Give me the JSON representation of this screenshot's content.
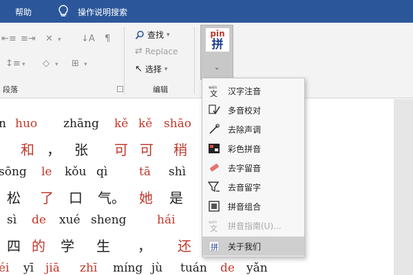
{
  "titlebar": {
    "help": "帮助",
    "bulb_icon": "lightbulb-icon",
    "search": "操作说明搜索"
  },
  "ribbon": {
    "paragraph_label": "段落",
    "edit_group": {
      "label": "编辑",
      "find": "查找",
      "replace": "Replace",
      "select": "选择"
    }
  },
  "pinyin_button": {
    "top": "pīn",
    "char": "拼"
  },
  "menu": {
    "items": [
      {
        "label": "汉字注音",
        "icon": "hanzi-zhuyin-icon",
        "enabled": true
      },
      {
        "label": "多音校对",
        "icon": "polyphone-check-icon",
        "enabled": true
      },
      {
        "label": "去除声调",
        "icon": "remove-tone-icon",
        "enabled": true
      },
      {
        "label": "彩色拼音",
        "icon": "color-pinyin-icon",
        "enabled": true
      },
      {
        "label": "去字留音",
        "icon": "eraser-icon",
        "enabled": true
      },
      {
        "label": "去音留字",
        "icon": "filter-icon",
        "enabled": true
      },
      {
        "label": "拼音组合",
        "icon": "pinyin-combine-icon",
        "enabled": true
      },
      {
        "label": "拼音指南(U)...",
        "icon": "pinyin-guide-icon",
        "enabled": false
      },
      {
        "label": "关于我们",
        "icon": "about-icon",
        "enabled": true
      }
    ]
  },
  "document": {
    "lines": [
      {
        "kind": "pinyin",
        "tokens": [
          {
            "t": "n",
            "red": false
          },
          {
            "t": "huo",
            "red": true
          },
          {
            "t": "zhāng",
            "red": false
          },
          {
            "t": "kě",
            "red": true
          },
          {
            "t": "kě",
            "red": true
          },
          {
            "t": "shāo",
            "red": true
          }
        ]
      },
      {
        "kind": "hanzi",
        "tokens": [
          {
            "t": "和",
            "red": true
          },
          {
            "t": "，",
            "red": false
          },
          {
            "t": "张",
            "red": false
          },
          {
            "t": "可",
            "red": true
          },
          {
            "t": "可",
            "red": true
          },
          {
            "t": "稍",
            "red": true
          }
        ]
      },
      {
        "kind": "pinyin",
        "tokens": [
          {
            "t": "sōng",
            "red": false
          },
          {
            "t": "le",
            "red": true
          },
          {
            "t": "kǒu",
            "red": false
          },
          {
            "t": "qì",
            "red": false
          },
          {
            "t": "tā",
            "red": true
          },
          {
            "t": "shì",
            "red": false
          }
        ]
      },
      {
        "kind": "hanzi",
        "tokens": [
          {
            "t": "松",
            "red": false
          },
          {
            "t": "了",
            "red": true
          },
          {
            "t": "口",
            "red": false
          },
          {
            "t": "气。",
            "red": false
          },
          {
            "t": "她",
            "red": true
          },
          {
            "t": "是",
            "red": false
          }
        ]
      },
      {
        "kind": "pinyin",
        "tokens": [
          {
            "t": "sì",
            "red": false
          },
          {
            "t": "de",
            "red": true
          },
          {
            "t": "xué",
            "red": false
          },
          {
            "t": "sheng",
            "red": false
          },
          {
            "t": "hái",
            "red": true
          }
        ]
      },
      {
        "kind": "hanzi",
        "tokens": [
          {
            "t": "四",
            "red": false
          },
          {
            "t": "的",
            "red": true
          },
          {
            "t": "学",
            "red": false
          },
          {
            "t": "生",
            "red": false
          },
          {
            "t": "，",
            "red": false
          },
          {
            "t": "还",
            "red": true
          }
        ]
      },
      {
        "kind": "pinyin",
        "tokens": [
          {
            "t": "éi",
            "red": true
          },
          {
            "t": "yī",
            "red": false
          },
          {
            "t": "jiā",
            "red": true
          },
          {
            "t": "zhī",
            "red": true
          },
          {
            "t": "míng",
            "red": false
          },
          {
            "t": "jù",
            "red": false
          },
          {
            "t": "tuán",
            "red": false
          },
          {
            "t": "de",
            "red": true
          },
          {
            "t": "yǎn",
            "red": false
          }
        ]
      }
    ]
  },
  "colors": {
    "titlebar": "#2b579a",
    "ribbon": "#f3f3f3",
    "pinyin_red": "#c0392b",
    "menu_highlight": "#cfcfcf"
  }
}
